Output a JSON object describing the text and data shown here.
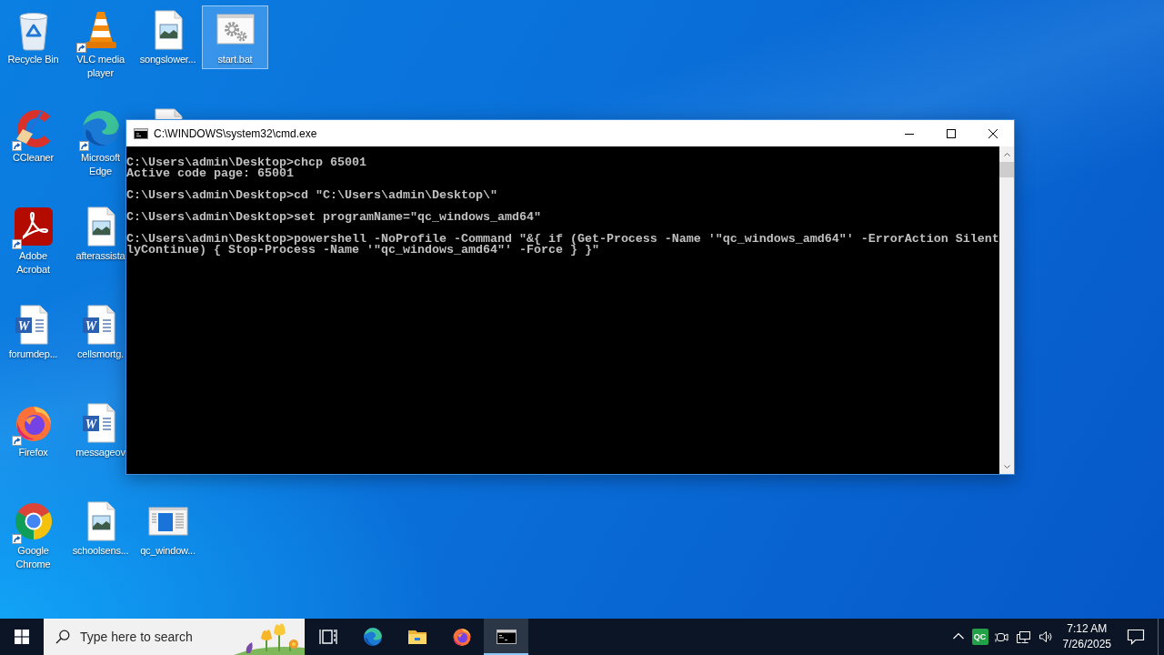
{
  "desktop": {
    "icon_rows": [
      [
        {
          "label": "Recycle Bin",
          "kind": "recycle-bin",
          "shortcut": false,
          "selected": false
        },
        {
          "label": "VLC media player",
          "kind": "vlc",
          "shortcut": true,
          "selected": false
        },
        {
          "label": "songslower...",
          "kind": "image-file",
          "shortcut": false,
          "selected": false
        },
        {
          "label": "start.bat",
          "kind": "batch-file",
          "shortcut": false,
          "selected": true
        }
      ],
      [
        {
          "label": "CCleaner",
          "kind": "ccleaner",
          "shortcut": true,
          "selected": false
        },
        {
          "label": "Microsoft Edge",
          "kind": "edge",
          "shortcut": true,
          "selected": false
        },
        {
          "kind": "word-doc",
          "shortcut": false,
          "selected": false
        }
      ],
      [
        {
          "label": "Adobe Acrobat",
          "kind": "acrobat",
          "shortcut": true,
          "selected": false
        },
        {
          "label": "afterassista",
          "kind": "image-file",
          "shortcut": false,
          "selected": false
        }
      ],
      [
        {
          "label": "forumdep...",
          "kind": "word-doc",
          "badge": "W",
          "shortcut": false,
          "selected": false
        },
        {
          "label": "cellsmortg.",
          "kind": "word-doc",
          "badge": "W",
          "shortcut": false,
          "selected": false
        }
      ],
      [
        {
          "label": "Firefox",
          "kind": "firefox",
          "shortcut": true,
          "selected": false
        },
        {
          "label": "messageov",
          "kind": "word-doc",
          "badge": "W",
          "shortcut": false,
          "selected": false
        }
      ],
      [
        {
          "label": "Google Chrome",
          "kind": "chrome",
          "shortcut": true,
          "selected": false
        },
        {
          "label": "schoolsens...",
          "kind": "image-file",
          "shortcut": false,
          "selected": false
        },
        {
          "label": "qc_window...",
          "kind": "app-window",
          "shortcut": false,
          "selected": false
        }
      ]
    ]
  },
  "window": {
    "title": "C:\\WINDOWS\\system32\\cmd.exe",
    "console_blocks": [
      [
        "C:\\Users\\admin\\Desktop>chcp 65001",
        "Active code page: 65001"
      ],
      [
        "C:\\Users\\admin\\Desktop>cd \"C:\\Users\\admin\\Desktop\\\""
      ],
      [
        "C:\\Users\\admin\\Desktop>set programName=\"qc_windows_amd64\""
      ],
      [
        "C:\\Users\\admin\\Desktop>powershell -NoProfile -Command \"&{ if (Get-Process -Name '\"qc_windows_amd64\"' -ErrorAction Silent",
        "lyContinue) { Stop-Process -Name '\"qc_windows_amd64\"' -Force } }\""
      ]
    ]
  },
  "taskbar": {
    "search": {
      "placeholder": "Type here to search"
    },
    "apps": [
      {
        "kind": "task-view",
        "selected": false
      },
      {
        "kind": "edge",
        "selected": false
      },
      {
        "kind": "file-explorer",
        "selected": false
      },
      {
        "kind": "firefox",
        "selected": false
      },
      {
        "kind": "console",
        "selected": true
      }
    ],
    "tray": [
      {
        "kind": "chevron"
      },
      {
        "kind": "app-tile",
        "label": "QC"
      },
      {
        "kind": "camera"
      },
      {
        "kind": "network"
      },
      {
        "kind": "volume"
      }
    ],
    "clock": {
      "time": "7:12 AM",
      "date": "7/26/2025"
    }
  }
}
